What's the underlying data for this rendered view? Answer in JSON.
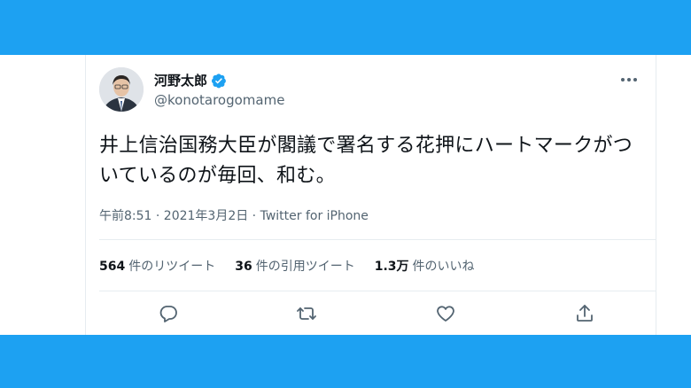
{
  "tweet": {
    "display_name": "河野太郎",
    "handle": "@konotarogomame",
    "text": "井上信治国務大臣が閣議で署名する花押にハートマークがついているのが毎回、和む。",
    "timestamp": "午前8:51 · 2021年3月2日 · Twitter for iPhone"
  },
  "stats": {
    "retweets": {
      "count": "564",
      "label": "件のリツイート"
    },
    "quotes": {
      "count": "36",
      "label": "件の引用ツイート"
    },
    "likes": {
      "count": "1.3万",
      "label": "件のいいね"
    }
  },
  "icons": {
    "verified": "verified-badge-icon",
    "more": "more-options-icon",
    "reply": "reply-icon",
    "retweet": "retweet-icon",
    "like": "heart-icon",
    "share": "share-icon"
  },
  "colors": {
    "brand": "#1da1f2",
    "text": "#0f1419",
    "secondary": "#536471",
    "divider": "#e6ecf0"
  }
}
